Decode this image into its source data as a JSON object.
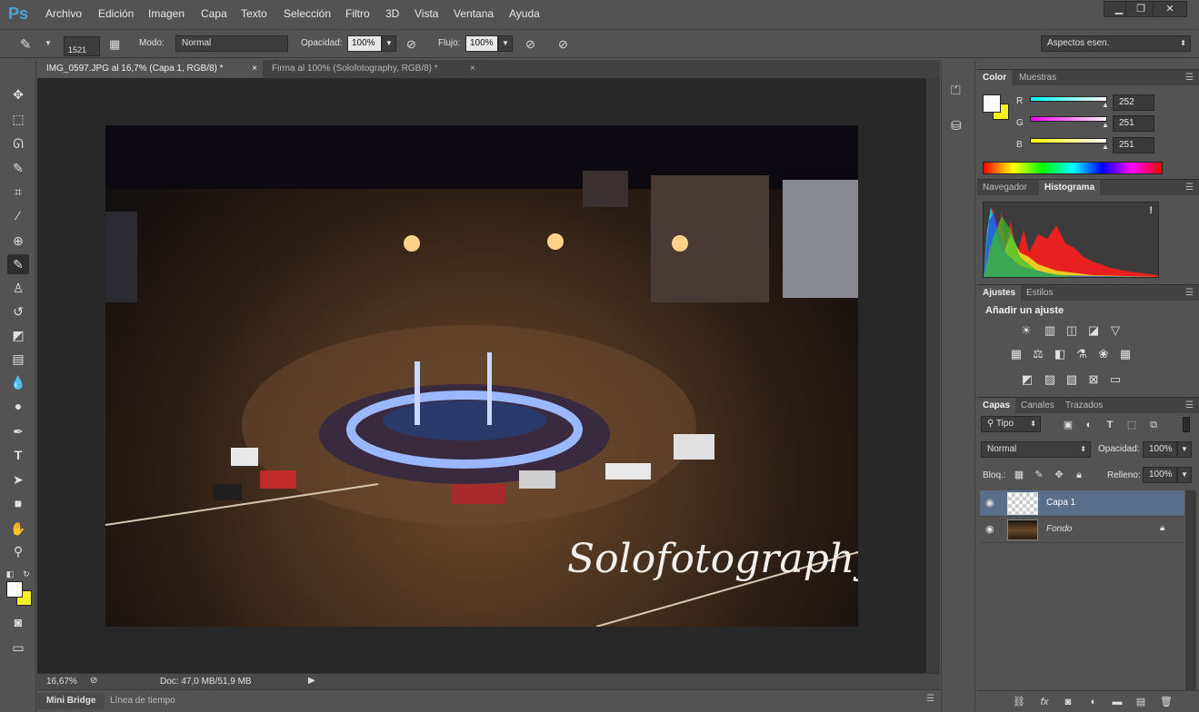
{
  "app": {
    "logo": "Ps"
  },
  "menu": [
    "Archivo",
    "Edición",
    "Imagen",
    "Capa",
    "Texto",
    "Selección",
    "Filtro",
    "3D",
    "Vista",
    "Ventana",
    "Ayuda"
  ],
  "window_controls": {
    "minimize": "▁",
    "maximize": "❐",
    "close": "✕"
  },
  "options": {
    "brush_size": "1521",
    "mode_label": "Modo:",
    "mode_value": "Normal",
    "opacity_label": "Opacidad:",
    "opacity_value": "100%",
    "flow_label": "Flujo:",
    "flow_value": "100%",
    "workspace": "Aspectos esen."
  },
  "tabs": [
    {
      "label": "IMG_0597.JPG al 16,7% (Capa 1, RGB/8) *",
      "close": "×"
    },
    {
      "label": "Firma al 100% (Solofotography, RGB/8) *",
      "close": "×"
    }
  ],
  "photo": {
    "watermark": "Solofotography"
  },
  "status": {
    "zoom": "16,67%",
    "doc": "Doc: 47,0 MB/51,9 MB"
  },
  "bottom_tabs": [
    "Mini Bridge",
    "Línea de tiempo"
  ],
  "color_panel": {
    "tabs": [
      "Color",
      "Muestras"
    ],
    "channels": [
      {
        "label": "R",
        "value": "252",
        "color": "#4fd6e0"
      },
      {
        "label": "G",
        "value": "251",
        "color": "#d04fd0"
      },
      {
        "label": "B",
        "value": "251",
        "color": "#e0e04f"
      }
    ],
    "foreground": "#fcfbfb",
    "background": "#f6f020"
  },
  "nav_panel": {
    "tabs": [
      "Navegador",
      "Histograma"
    ],
    "warning": "!"
  },
  "adjust_panel": {
    "tabs": [
      "Ajustes",
      "Estilos"
    ],
    "title": "Añadir un ajuste"
  },
  "layers_panel": {
    "tabs": [
      "Capas",
      "Canales",
      "Trazados"
    ],
    "filter": "Tipo",
    "blend": "Normal",
    "opacity_label": "Opacidad:",
    "opacity_value": "100%",
    "lock_label": "Bloq.:",
    "fill_label": "Relleno:",
    "fill_value": "100%",
    "layers": [
      {
        "name": "Capa 1",
        "selected": true
      },
      {
        "name": "Fondo",
        "selected": false
      }
    ]
  }
}
